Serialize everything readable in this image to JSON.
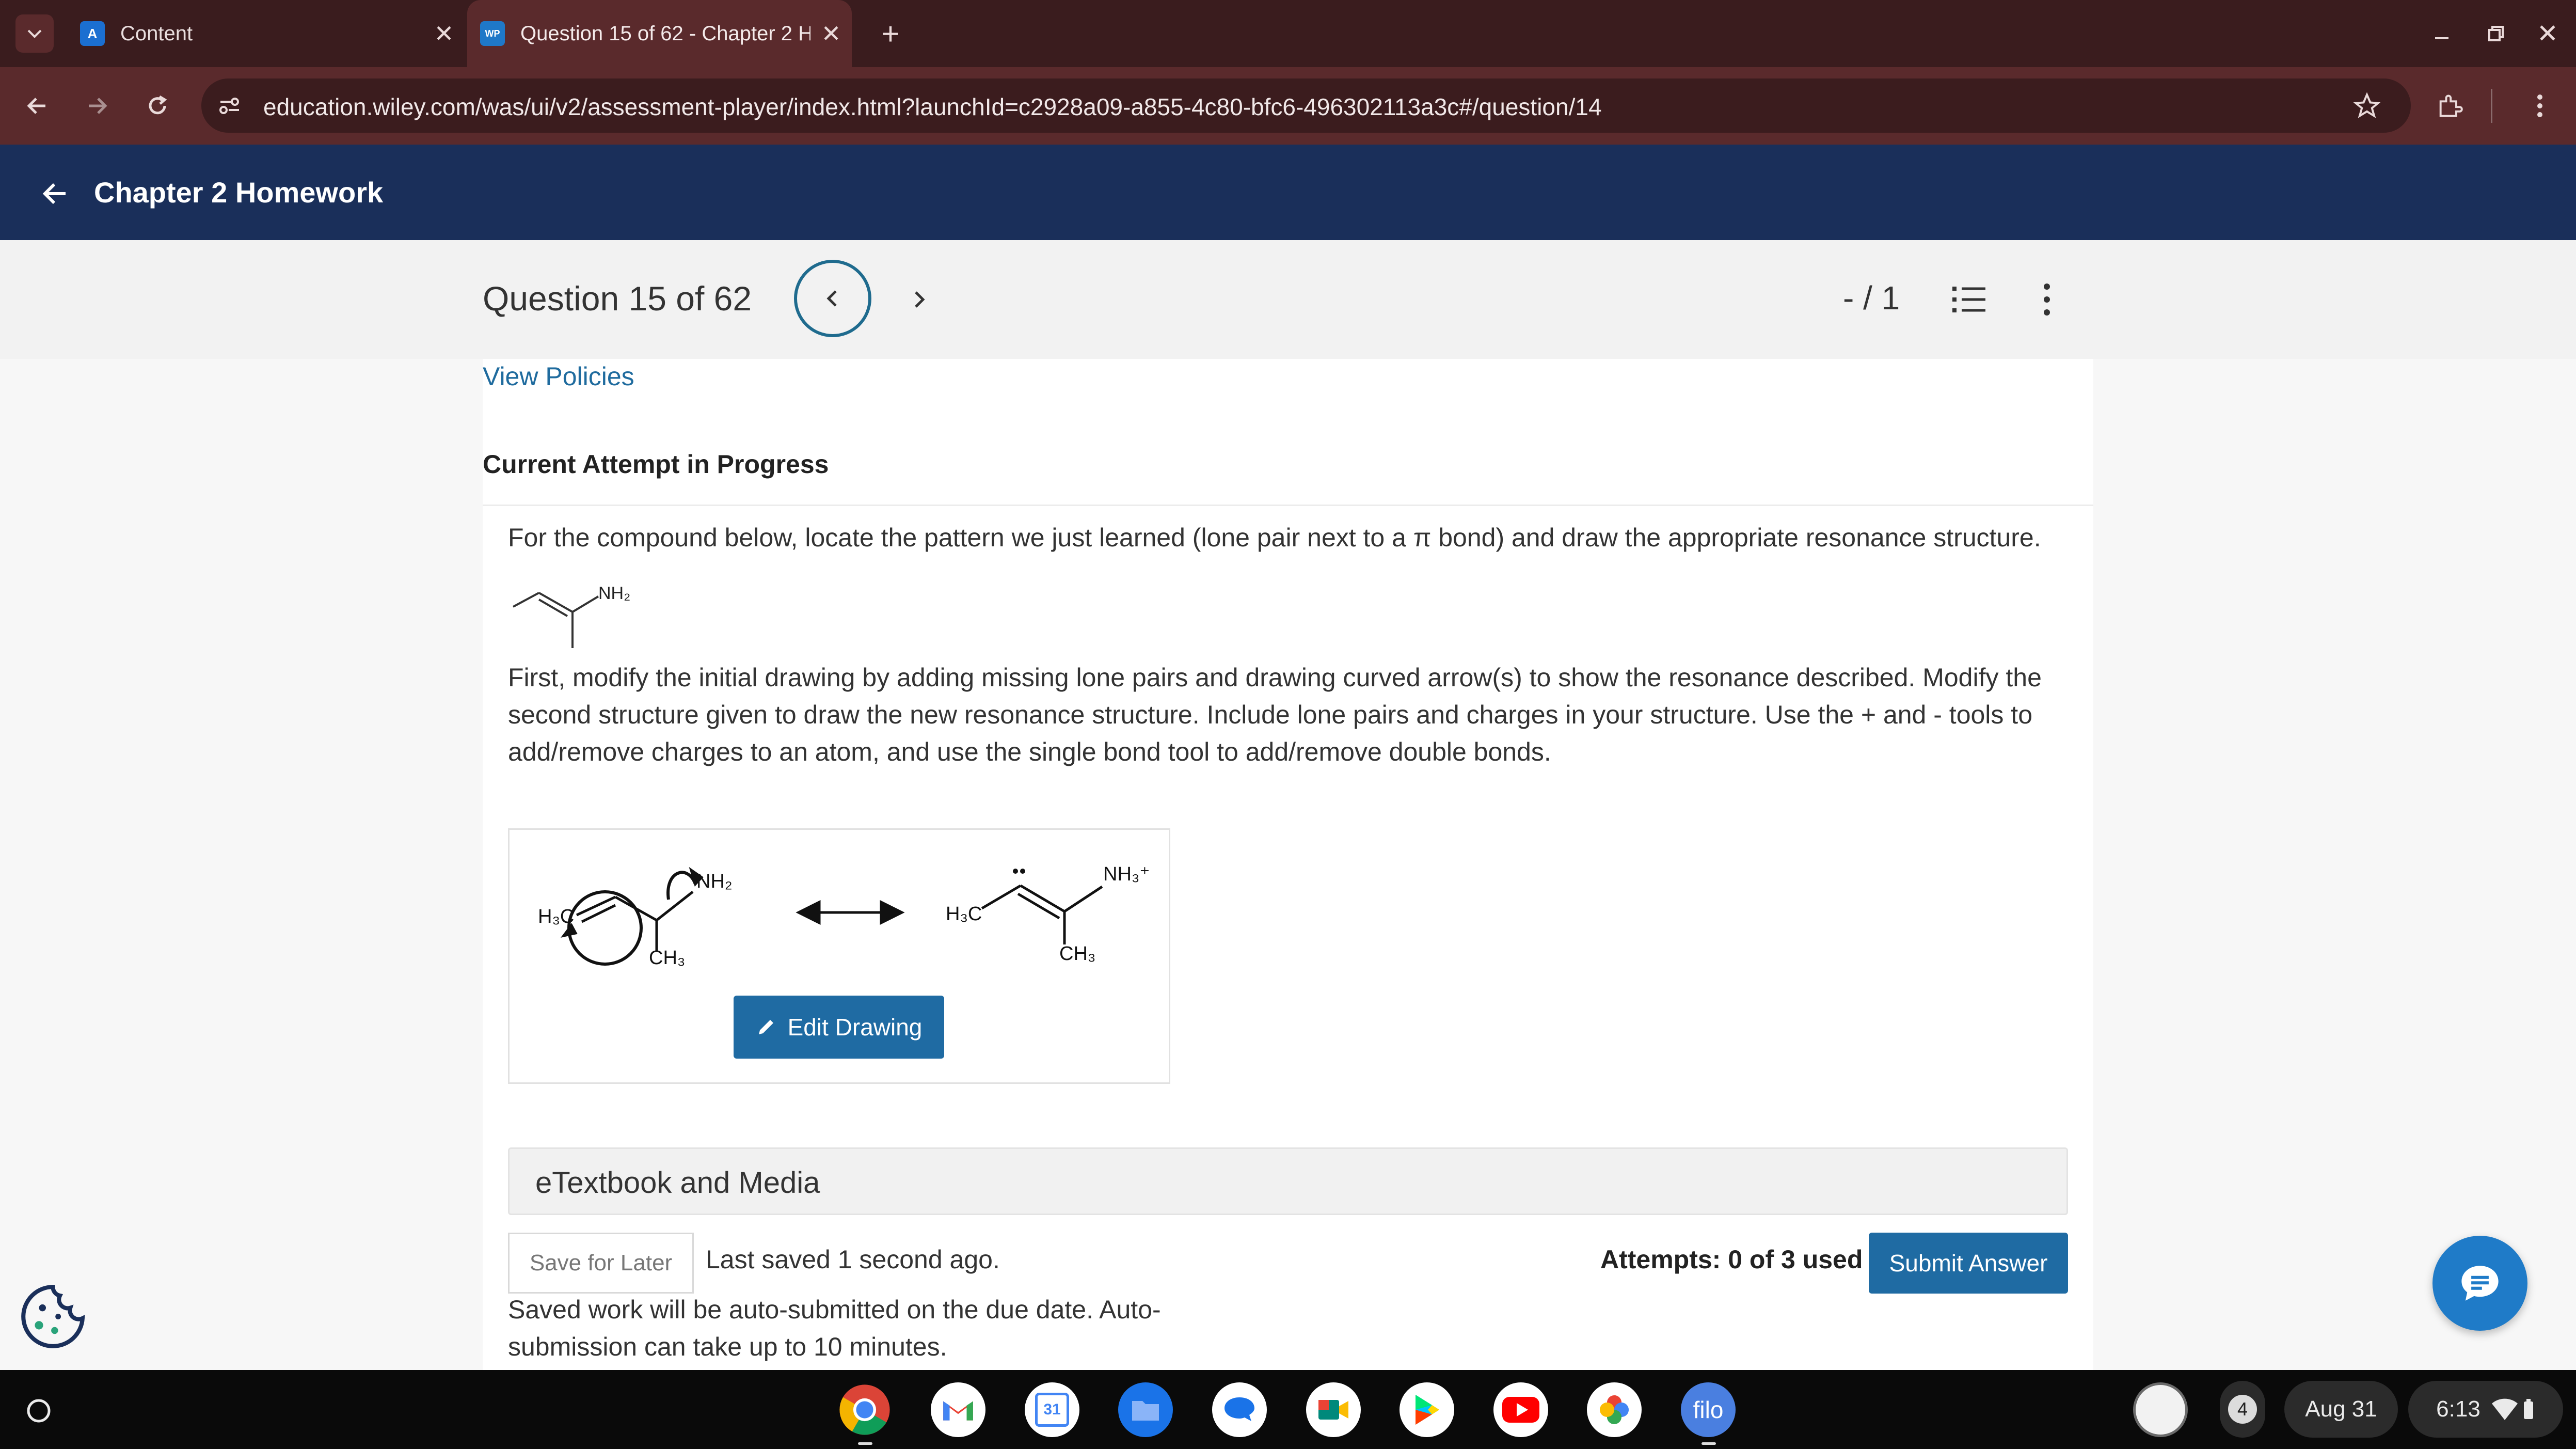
{
  "browser": {
    "tabs": [
      {
        "title": "Content",
        "favicon_text": "A",
        "favicon_color": "#1b6fd1"
      },
      {
        "title": "Question 15 of 62 - Chapter 2 H",
        "favicon_text": "WP",
        "favicon_color": "#1f78c8"
      }
    ],
    "new_tab_symbol": "+",
    "url": "education.wiley.com/was/ui/v2/assessment-player/index.html?launchId=c2928a09-a855-4c80-bfc6-496302113a3c#/question/14"
  },
  "header": {
    "title": "Chapter 2 Homework"
  },
  "question_nav": {
    "title": "Question 15 of 62",
    "score": "- / 1"
  },
  "content": {
    "view_policies": "View Policies",
    "attempt_heading": "Current Attempt in Progress",
    "question_text": "For the compound below, locate the pattern we just learned (lone pair next to a π bond) and draw the appropriate resonance structure.",
    "compound_label": "NH₂",
    "instructions": "First, modify the initial drawing by adding missing lone pairs and drawing curved arrow(s) to show the resonance described. Modify the second structure given to draw the new resonance structure. Include lone pairs and charges in your structure. Use the + and - tools to add/remove charges to an atom, and use the single bond tool to add/remove double bonds.",
    "drawing": {
      "left_labels": {
        "h3c": "H₃C",
        "nh2": "NH₂",
        "ch3": "CH₃"
      },
      "right_labels": {
        "h3c": "H₃C",
        "nh3": "NH₃⁺",
        "ch3": "CH₃"
      }
    },
    "edit_drawing": "Edit Drawing",
    "etextbook": "eTextbook and Media",
    "save_for_later": "Save for Later",
    "last_saved": "Last saved 1 second ago.",
    "attempts": "Attempts: 0 of 3 used",
    "submit": "Submit Answer",
    "autosubmit_note": "Saved work will be auto-submitted on the due date. Auto-submission can take up to 10 minutes."
  },
  "taskbar": {
    "apps": [
      "chrome-icon",
      "gmail-icon",
      "calendar-icon",
      "files-icon",
      "chat-icon",
      "meet-icon",
      "play-store-icon",
      "youtube-icon",
      "photos-icon",
      "filo-icon"
    ],
    "calendar_day": "31",
    "filo_label": "filo",
    "notification_count": "4",
    "date": "Aug 31",
    "time": "6:13"
  }
}
